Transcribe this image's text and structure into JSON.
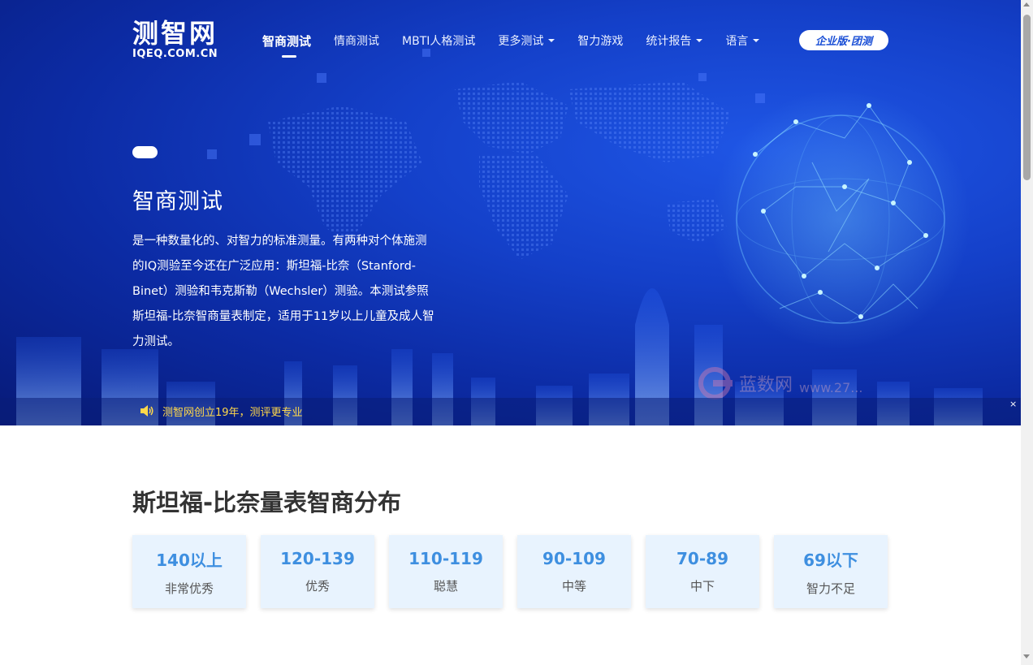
{
  "logo": {
    "cn": "测智网",
    "en": "IQEQ.COM.CN"
  },
  "nav": {
    "items": [
      {
        "label": "智商测试",
        "active": true,
        "dropdown": false
      },
      {
        "label": "情商测试",
        "active": false,
        "dropdown": false
      },
      {
        "label": "MBTI人格测试",
        "active": false,
        "dropdown": false
      },
      {
        "label": "更多测试",
        "active": false,
        "dropdown": true
      },
      {
        "label": "智力游戏",
        "active": false,
        "dropdown": false
      },
      {
        "label": "统计报告",
        "active": false,
        "dropdown": true
      },
      {
        "label": "语言",
        "active": false,
        "dropdown": true
      }
    ],
    "enterprise_button": "企业版·团测"
  },
  "hero": {
    "title": "智商测试",
    "description": "是一种数量化的、对智力的标准测量。有两种对个体施测的IQ测验至今还在广泛应用：斯坦福-比奈（Stanford-Binet）测验和韦克斯勒（Wechsler）测验。本测试参照斯坦福-比奈智商量表制定，适用于11岁以上儿童及成人智力测试。"
  },
  "notice": {
    "icon": "speaker-icon",
    "text": "测智网创立19年，测评更专业",
    "close": "×"
  },
  "watermark": {
    "text": "蓝数网",
    "url": "www.27..."
  },
  "section": {
    "title": "斯坦福-比奈量表智商分布",
    "cards": [
      {
        "range": "140以上",
        "label": "非常优秀"
      },
      {
        "range": "120-139",
        "label": "优秀"
      },
      {
        "range": "110-119",
        "label": "聪慧"
      },
      {
        "range": "90-109",
        "label": "中等"
      },
      {
        "range": "70-89",
        "label": "中下"
      },
      {
        "range": "69以下",
        "label": "智力不足"
      }
    ]
  },
  "colors": {
    "hero_bg": "#1440c9",
    "accent_blue": "#3e8fe0",
    "card_bg": "#e8f3fe",
    "notice_text": "#ffd84a",
    "title_text": "#333333"
  }
}
